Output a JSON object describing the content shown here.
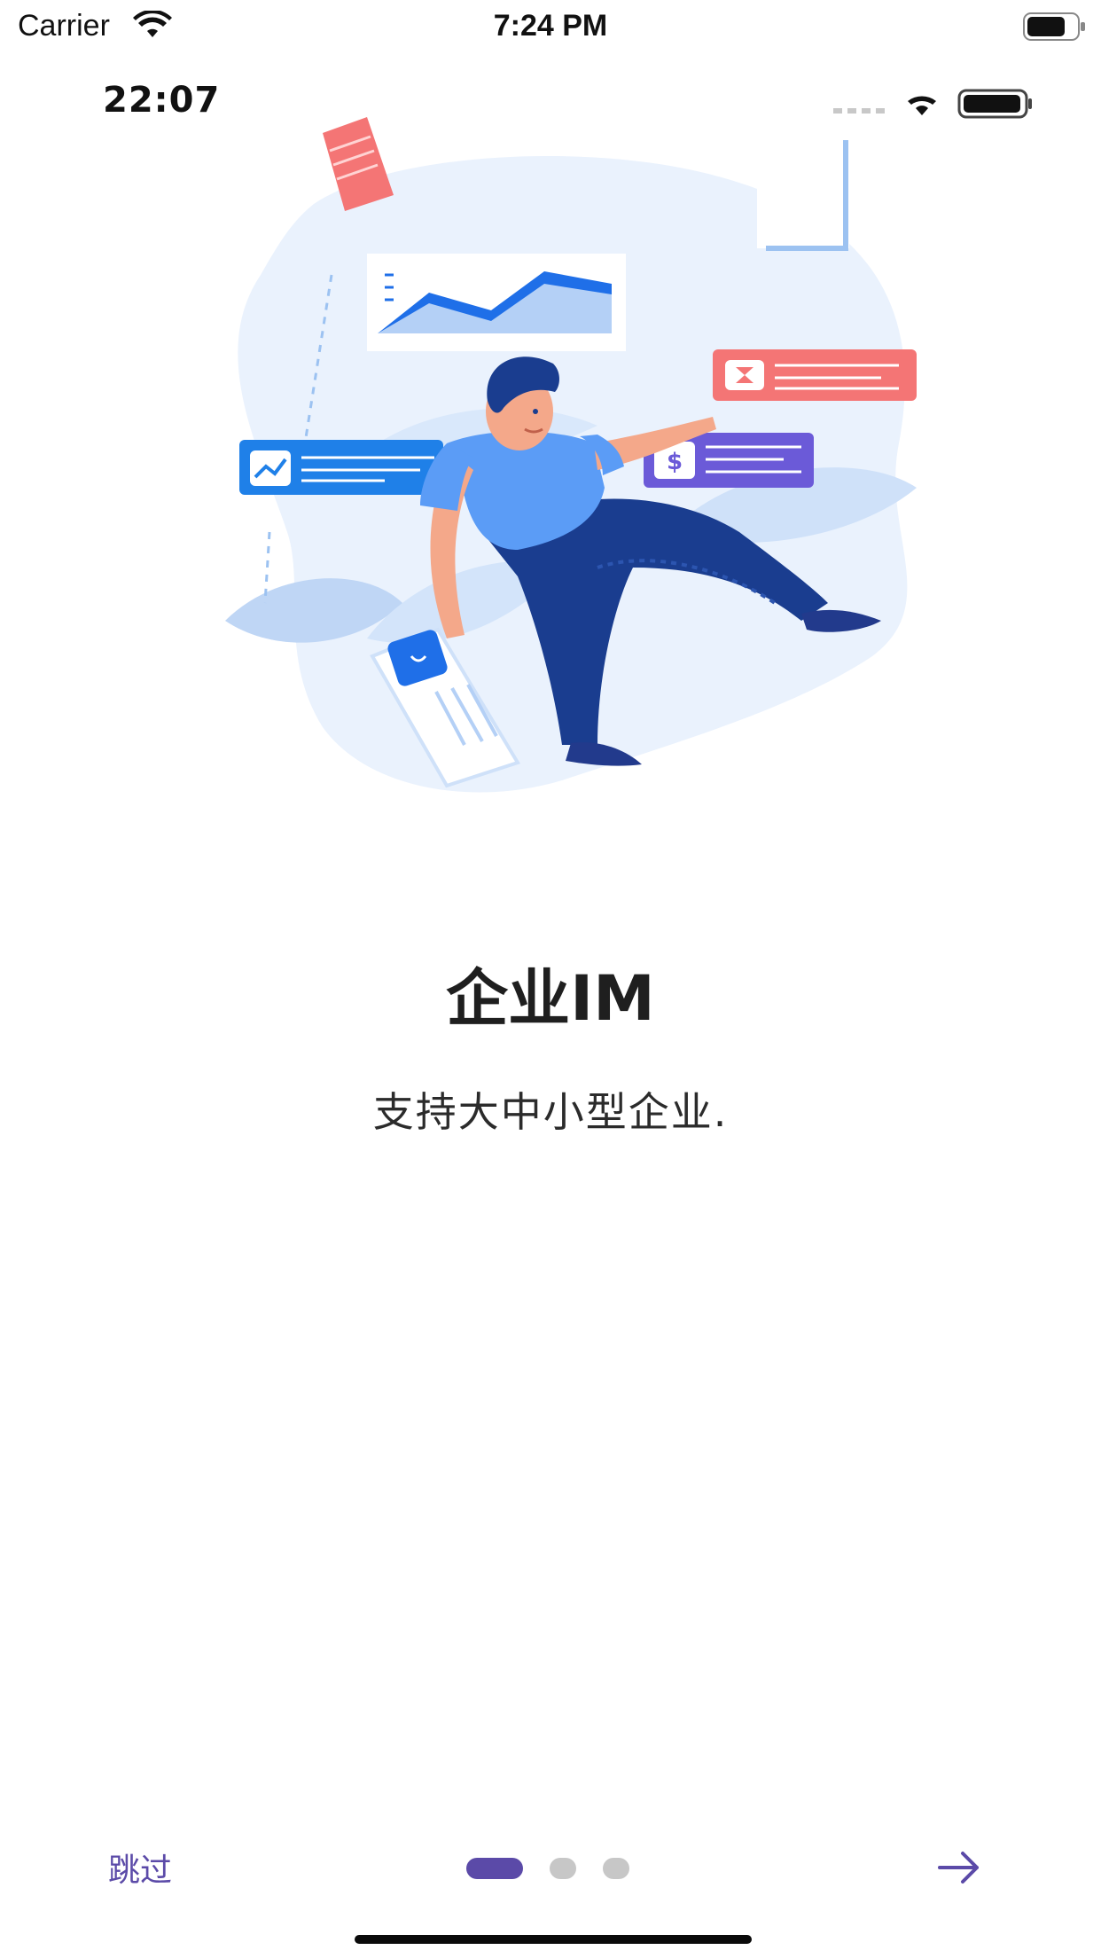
{
  "status_bar": {
    "carrier": "Carrier",
    "time": "7:24 PM",
    "wifi_icon": "wifi-icon",
    "battery_icon": "battery-icon"
  },
  "hero": {
    "inner_status_time": "22:07",
    "illustration": "person-floating-with-charts-illustration"
  },
  "onboarding": {
    "title": "企业IM",
    "subtitle": "支持大中小型企业."
  },
  "controls": {
    "skip_label": "跳过",
    "page_count": 3,
    "active_page": 1,
    "next_icon": "arrow-right-icon"
  },
  "colors": {
    "accent": "#5b4aa8",
    "dot_inactive": "#c7c7c7",
    "illustration_blue": "#1f6fe8",
    "illustration_red": "#f47575"
  }
}
